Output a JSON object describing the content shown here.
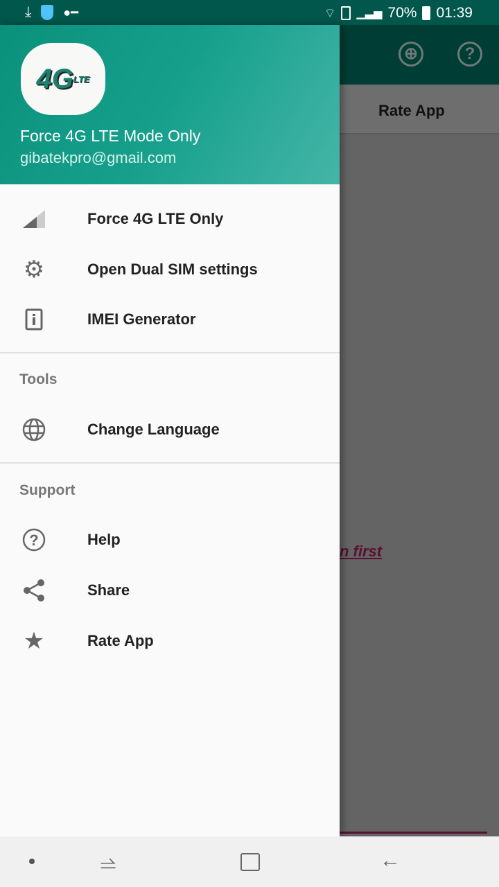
{
  "status_bar": {
    "battery": "70%",
    "time": "01:39",
    "icons": [
      "download-icon",
      "vpn-shield-icon",
      "key-icon",
      "wifi-icon",
      "sim-icon",
      "signal-icon",
      "signal-icon",
      "battery-charging-icon"
    ]
  },
  "background": {
    "tab_label": "Rate App",
    "link_text": "n first",
    "icons": [
      "globe-icon",
      "help-icon"
    ]
  },
  "drawer": {
    "header": {
      "logo_text": "4G",
      "logo_sub": "LTE",
      "title": "Force 4G LTE Mode Only",
      "email": "gibatekpro@gmail.com"
    },
    "items": [
      {
        "label": "Force 4G LTE Only",
        "icon": "signal-icon"
      },
      {
        "label": "Open Dual SIM settings",
        "icon": "gear-icon"
      },
      {
        "label": "IMEI Generator",
        "icon": "phone-info-icon"
      }
    ],
    "tools": {
      "title": "Tools",
      "items": [
        {
          "label": "Change Language",
          "icon": "globe-icon"
        }
      ]
    },
    "support": {
      "title": "Support",
      "items": [
        {
          "label": "Help",
          "icon": "help-icon"
        },
        {
          "label": "Share",
          "icon": "share-icon"
        },
        {
          "label": "Rate App",
          "icon": "star-icon"
        }
      ]
    }
  },
  "colors": {
    "primary": "#0a917c",
    "status_bar": "#01574b",
    "link": "#5a1030"
  }
}
